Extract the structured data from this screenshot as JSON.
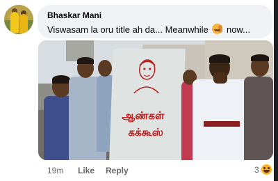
{
  "comment": {
    "author": "Bhaskar Mani",
    "text_before": "Viswasam la oru title ah da... Meanwhile",
    "text_after": "now...",
    "emoji_icon": "face-with-hand-over-mouth-emoji"
  },
  "media": {
    "sign_line1": "ஆண்கள்",
    "sign_line2": "கக்கூஸ்"
  },
  "actions": {
    "timestamp": "19m",
    "like_label": "Like",
    "reply_label": "Reply"
  },
  "reactions": {
    "count": "3",
    "icon": "haha-reaction-icon"
  },
  "colors": {
    "bubble_bg": "#f0f2f5",
    "meta_text": "#65676b",
    "sign_text": "#c01a1a"
  }
}
